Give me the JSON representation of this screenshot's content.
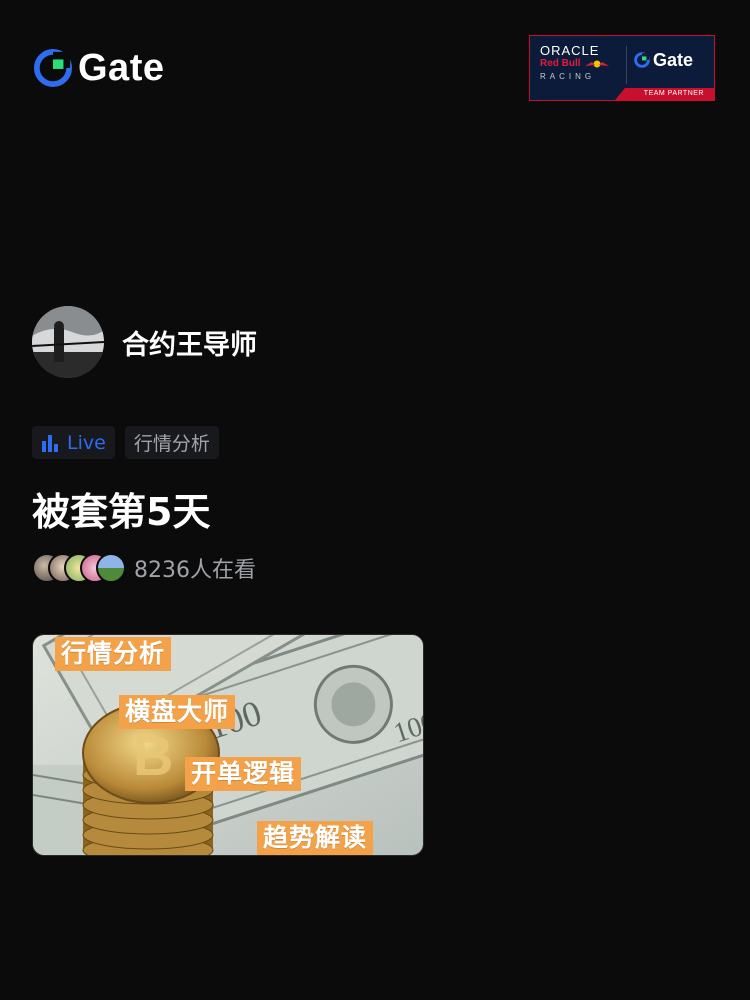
{
  "header": {
    "brand_name": "Gate",
    "partner_badge": {
      "oracle": "ORACLE",
      "redbull": "Red Bull",
      "racing": "RACING",
      "gate": "Gate",
      "team_partner": "TEAM PARTNER"
    }
  },
  "colors": {
    "accent": "#2e6cf0",
    "brand_green": "#28e07a",
    "background": "#0b0b0c",
    "label_orange": "#f4a24a"
  },
  "host": {
    "name": "合约王导师"
  },
  "tags": {
    "live_label": "Live",
    "category_label": "行情分析"
  },
  "stream": {
    "title": "被套第5天",
    "viewers_text": "8236人在看"
  },
  "cover": {
    "labels": [
      "行情分析",
      "横盘大师",
      "开单逻辑",
      "趋势解读"
    ]
  }
}
